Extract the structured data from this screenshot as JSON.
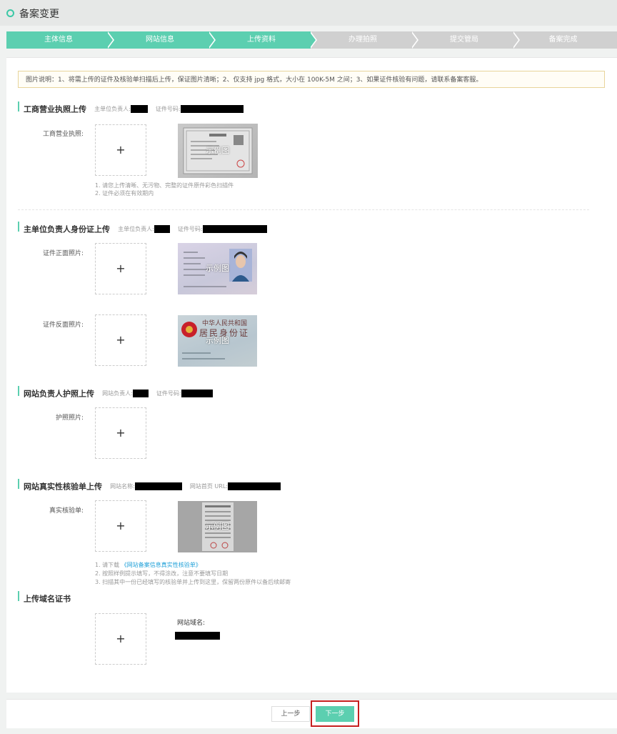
{
  "header": {
    "title": "备案变更"
  },
  "steps": [
    {
      "label": "主体信息",
      "state": "active"
    },
    {
      "label": "网站信息",
      "state": "active"
    },
    {
      "label": "上传资料",
      "state": "active"
    },
    {
      "label": "办理拍照",
      "state": "inactive"
    },
    {
      "label": "提交管局",
      "state": "inactive"
    },
    {
      "label": "备案完成",
      "state": "inactive"
    }
  ],
  "notice": "图片说明：1、将需上传的证件及核验单扫描后上传，保证图片清晰；2、仅支持 jpg 格式，大小在 100K-5M 之间；3、如果证件核验有问题，请联系备案客服。",
  "sections": {
    "business": {
      "title": "工商营业执照上传",
      "owner_key": "主单位负责人:",
      "cert_key": "证件号码:",
      "field_label": "工商营业执照:",
      "sample_caption": "示例图",
      "upload_plus": "+",
      "hint1": "1. 请您上传清晰、无污物、完整的证件原件彩色扫描件",
      "hint2": "2. 证件必须在有效期内"
    },
    "idcard": {
      "title": "主单位负责人身份证上传",
      "owner_key": "主单位负责人:",
      "cert_key": "证件号码:",
      "front_label": "证件正面照片:",
      "back_label": "证件反面照片:",
      "sample_caption": "示例图",
      "upload_plus": "+",
      "back_card_title1": "中华人民共和国",
      "back_card_title2": "居民身份证"
    },
    "passport": {
      "title": "网站负责人护照上传",
      "owner_key": "网站负责人:",
      "cert_key": "证件号码:",
      "field_label": "护照照片:",
      "upload_plus": "+"
    },
    "verify": {
      "title": "网站真实性核验单上传",
      "name_key": "网站名称:",
      "url_key": "网站首页 URL:",
      "field_label": "真实核验单:",
      "sample_caption": "示例图",
      "upload_plus": "+",
      "hint1_prefix": "1. 请下载",
      "hint1_link": "《网站备案信息真实性核验单》",
      "hint2": "2. 按照样例提示填写，不得涂改，注意不要填写日期",
      "hint3": "3. 扫描其中一份已经填写的核验单并上传到这里，保留两份原件以备后续邮寄"
    },
    "domain": {
      "title": "上传域名证书",
      "domain_key": "网站域名:",
      "upload_plus": "+"
    }
  },
  "footer": {
    "prev_label": "上一步",
    "next_label": "下一步"
  },
  "colors": {
    "accent": "#5ccfb0",
    "inactive_step": "#d0d0d0",
    "highlight_border": "#c61f1f",
    "link": "#1fa0d8"
  }
}
